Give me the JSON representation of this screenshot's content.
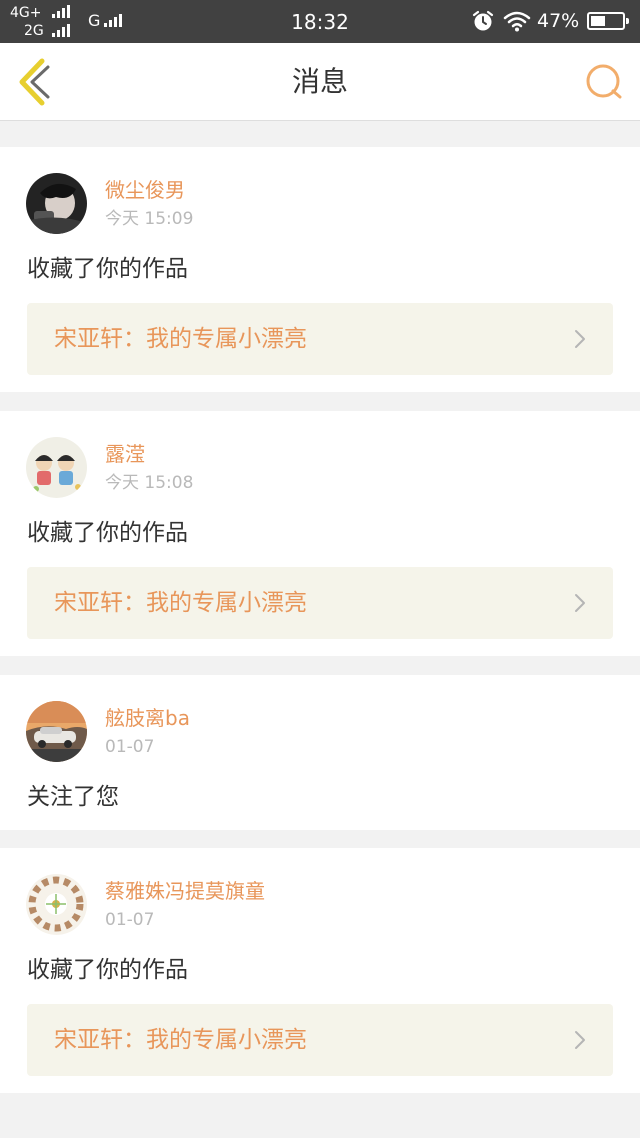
{
  "status_bar": {
    "network_1": "4G+",
    "network_2": "2G",
    "network_3": "G",
    "time": "18:32",
    "battery_percent": "47%",
    "battery_level": 0.47,
    "icons": [
      "alarm-icon",
      "wifi-icon",
      "battery-icon"
    ]
  },
  "nav": {
    "title": "消息",
    "back_icon": "chevron-left-icon",
    "search_icon": "search-icon",
    "accent_color": "#f2ad6b",
    "back_color": "#e7cf2f"
  },
  "messages": [
    {
      "user": "微尘俊男",
      "time": "今天 15:09",
      "action": "收藏了你的作品",
      "work": "宋亚轩：我的专属小漂亮"
    },
    {
      "user": "露滢",
      "time": "今天 15:08",
      "action": "收藏了你的作品",
      "work": "宋亚轩：我的专属小漂亮"
    },
    {
      "user": "舷肢离ba",
      "time": "01-07",
      "action": "关注了您"
    },
    {
      "user": "蔡雅姝冯提莫旗童",
      "time": "01-07",
      "action": "收藏了你的作品",
      "work": "宋亚轩：我的专属小漂亮"
    }
  ],
  "colors": {
    "name": "#e8965a",
    "work_bg": "#f5f4ea",
    "page_bg": "#f2f2f2",
    "status_bar_bg": "#414141"
  }
}
